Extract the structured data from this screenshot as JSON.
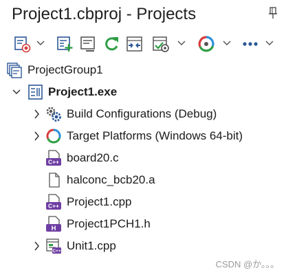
{
  "window": {
    "title": "Project1.cbproj - Projects"
  },
  "toolbar": {
    "buttons": [
      {
        "icon": "new-project-icon",
        "has_dropdown": true
      },
      {
        "icon": "add-new-item-icon",
        "has_dropdown": false
      },
      {
        "icon": "remove-item-icon",
        "has_dropdown": false
      },
      {
        "icon": "refresh-icon",
        "has_dropdown": false
      },
      {
        "icon": "sync-icon",
        "has_dropdown": false
      },
      {
        "icon": "build-config-icon",
        "has_dropdown": true
      },
      {
        "icon": "target-platform-icon",
        "has_dropdown": true
      },
      {
        "icon": "more-options-icon",
        "has_dropdown": true
      }
    ]
  },
  "tree": {
    "items": [
      {
        "label": "ProjectGroup1",
        "icon": "project-group-icon",
        "level": 0,
        "expander": "none",
        "bold": false
      },
      {
        "label": "Project1.exe",
        "icon": "exe-project-icon",
        "level": 1,
        "expander": "expanded",
        "bold": true
      },
      {
        "label": "Build Configurations (Debug)",
        "icon": "gears-icon",
        "level": 2,
        "expander": "collapsed",
        "bold": false
      },
      {
        "label": "Target Platforms (Windows 64-bit)",
        "icon": "target-platforms-icon",
        "level": 2,
        "expander": "collapsed",
        "bold": false
      },
      {
        "label": "board20.c",
        "icon": "cpp-file-icon",
        "level": 2,
        "expander": "none",
        "bold": false
      },
      {
        "label": "halconc_bcb20.a",
        "icon": "plain-file-icon",
        "level": 2,
        "expander": "none",
        "bold": false
      },
      {
        "label": "Project1.cpp",
        "icon": "cpp-file-icon",
        "level": 2,
        "expander": "none",
        "bold": false
      },
      {
        "label": "Project1PCH1.h",
        "icon": "header-file-icon",
        "level": 2,
        "expander": "none",
        "bold": false
      },
      {
        "label": "Unit1.cpp",
        "icon": "unit-form-icon",
        "level": 2,
        "expander": "collapsed",
        "bold": false
      }
    ]
  },
  "watermark": "CSDN @か。。。",
  "colors": {
    "purple_badge": "#6e3fa3",
    "blue_icon": "#2b5797",
    "green_refresh": "#2e9e44",
    "red_accent": "#d83b3b"
  }
}
